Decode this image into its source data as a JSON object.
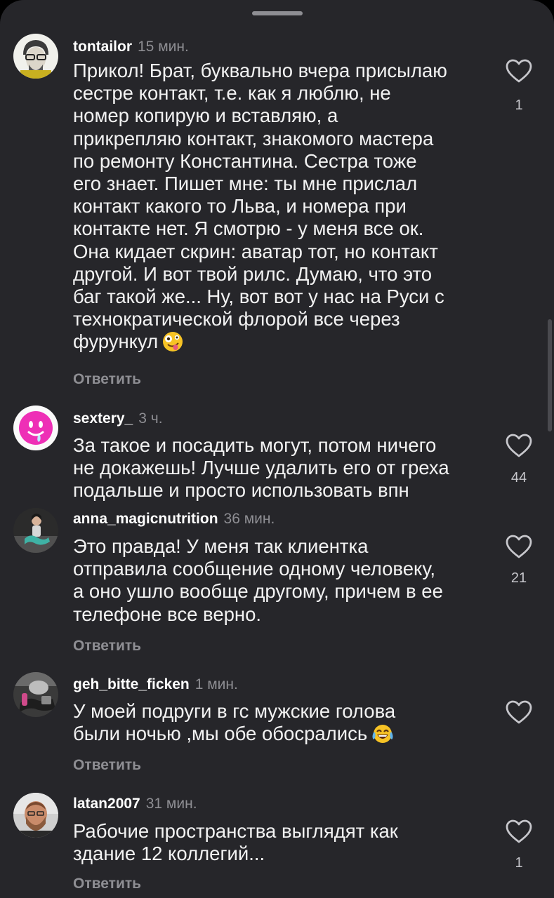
{
  "comments": [
    {
      "username": "tontailor",
      "time": "15 мин.",
      "text": "Прикол! Брат, буквально вчера присылаю\nсестре контакт, т.е. как я люблю, не\nномер копирую и вставляю, а\nприкрепляю контакт, знакомого мастера\nпо ремонту Константина. Сестра тоже\nего знает. Пишет мне: ты мне прислал\nконтакт какого то Льва, и номера при\nконтакте нет. Я смотрю - у меня все ок.\nОна кидает скрин: аватар тот, но контакт\nдругой. И вот твой рилс. Думаю, что это\nбаг такой же...  Ну, вот вот у нас на Руси с\nтехнократической флорой все через\nфурункул",
      "emoji": "zany-face",
      "reply": "Ответить",
      "likes": "1"
    },
    {
      "username": "sextery_",
      "time": "3 ч.",
      "text": "За такое и посадить могут, потом ничего\nне докажешь! Лучше удалить его от греха\nподальше и просто использовать впн",
      "likes": "44"
    },
    {
      "username": "anna_magicnutrition",
      "time": "36 мин.",
      "text": "Это правда! У меня так клиентка\nотправила сообщение одному человеку,\nа оно ушло вообще другому, причем в ее\nтелефоне все верно.",
      "reply": "Ответить",
      "likes": "21"
    },
    {
      "username": "geh_bitte_ficken",
      "time": "1 мин.",
      "text": "У моей подруги в гс мужские голова\nбыли ночью ,мы обе обосрались",
      "emoji": "tears-of-joy-face",
      "reply": "Ответить",
      "likes": ""
    },
    {
      "username": "latan2007",
      "time": "31 мин.",
      "text": "Рабочие пространства выглядят как\nздание 12 коллегий...",
      "reply": "Ответить",
      "likes": "1"
    }
  ],
  "icons": {
    "like": "heart-outline-icon"
  },
  "colors": {
    "background": "#26262a",
    "text": "#f2f2f2",
    "secondary": "#8e8e93"
  }
}
